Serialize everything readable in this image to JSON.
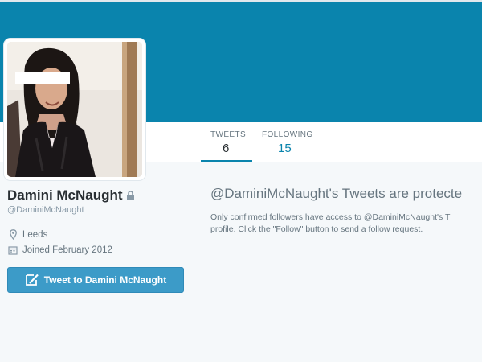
{
  "profile": {
    "name": "Damini McNaught",
    "screen_name": "@DaminiMcNaught",
    "location": "Leeds",
    "joined": "Joined February 2012",
    "protected": true
  },
  "nav": {
    "tabs": [
      {
        "label": "TWEETS",
        "value": "6",
        "active": true
      },
      {
        "label": "FOLLOWING",
        "value": "15",
        "active": false
      }
    ]
  },
  "actions": {
    "tweet_to_label": "Tweet to Damini McNaught"
  },
  "protected_notice": {
    "title": "@DaminiMcNaught's Tweets are protecte",
    "body_line1": "Only confirmed followers have access to @DaminiMcNaught's T",
    "body_line2": "profile. Click the \"Follow\" button to send a follow request."
  },
  "icons": {
    "lock": "lock-icon",
    "location": "map-pin-icon",
    "calendar": "calendar-icon",
    "compose": "compose-icon"
  },
  "colors": {
    "banner": "#0a84ad",
    "accent": "#0a84ad",
    "button": "#3c9bc8",
    "background": "#f5f8fa"
  }
}
